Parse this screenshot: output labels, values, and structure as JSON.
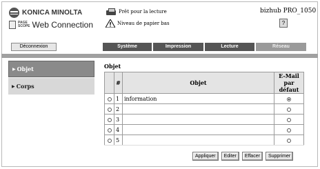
{
  "brand": {
    "name": "KONICA MINOLTA",
    "pagescope_small": [
      "PAGE",
      "SCOPE"
    ],
    "title": "Web Connection"
  },
  "status": {
    "printer": "Prêt pour la lecture",
    "paper": "Niveau de papier bas"
  },
  "model": "bizhub PRO_1050",
  "nav": {
    "logout": "Déconnexion",
    "tabs": [
      "Système",
      "Impression",
      "Lecture",
      "Réseau"
    ]
  },
  "menu": [
    {
      "label": "Objet",
      "active": true
    },
    {
      "label": "Corps",
      "active": false
    }
  ],
  "main": {
    "title": "Objet",
    "headers": {
      "num": "#",
      "subject": "Objet",
      "email": "E-Mail par défaut"
    },
    "rows": [
      {
        "num": "1",
        "subject": "information",
        "default": true
      },
      {
        "num": "2",
        "subject": "",
        "default": false
      },
      {
        "num": "3",
        "subject": "",
        "default": false
      },
      {
        "num": "4",
        "subject": "",
        "default": false
      },
      {
        "num": "5",
        "subject": "",
        "default": false
      }
    ]
  },
  "buttons": [
    "Appliquer",
    "Editer",
    "Effacer",
    "Supprimer"
  ]
}
